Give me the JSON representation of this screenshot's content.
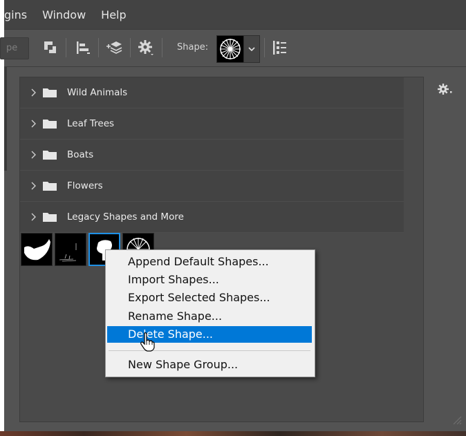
{
  "menubar": {
    "items": [
      "gins",
      "Window",
      "Help"
    ]
  },
  "optionsbar": {
    "field_text": "pe",
    "shape_label": "Shape:",
    "shape_icon": "starburst-shape"
  },
  "shapes_panel": {
    "groups": [
      {
        "label": "Wild Animals"
      },
      {
        "label": "Leaf Trees"
      },
      {
        "label": "Boats"
      },
      {
        "label": "Flowers"
      },
      {
        "label": "Legacy Shapes and More"
      }
    ],
    "thumbnails": [
      "boat-shape",
      "grass-shape",
      "leaf-shape",
      "starburst-shape"
    ],
    "selected_index": 2
  },
  "context_menu": {
    "items": [
      {
        "label": "Append Default Shapes..."
      },
      {
        "label": "Import Shapes..."
      },
      {
        "label": "Export Selected Shapes..."
      },
      {
        "label": "Rename Shape..."
      },
      {
        "label": "Delete Shape...",
        "highlighted": true
      },
      {
        "label": "New Shape Group..."
      }
    ]
  },
  "colors": {
    "highlight": "#0078d7",
    "selection_border": "#1e90e6",
    "panel_bg": "#535353"
  }
}
